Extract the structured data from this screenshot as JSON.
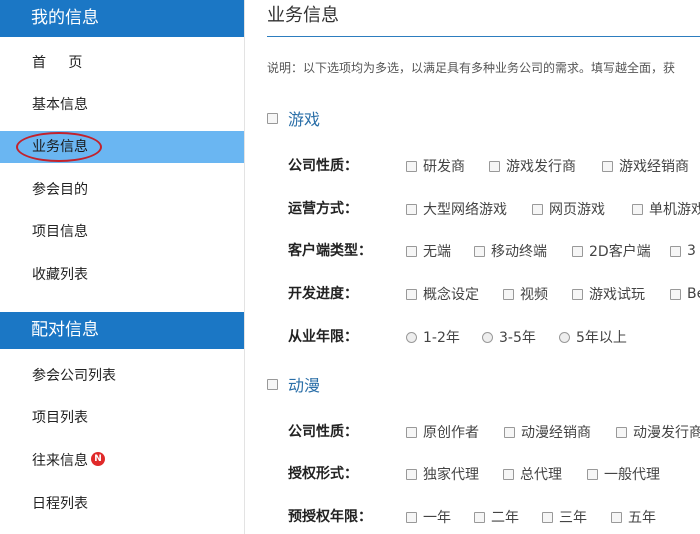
{
  "sidebar": {
    "section1_title": "我的信息",
    "section1_items": [
      "首页",
      "基本信息",
      "业务信息",
      "参会目的",
      "项目信息",
      "收藏列表"
    ],
    "section2_title": "配对信息",
    "section2_items": [
      "参会公司列表",
      "项目列表",
      "往来信息",
      "日程列表"
    ],
    "badge": "N"
  },
  "main": {
    "title": "业务信息",
    "description": "说明：以下选项均为多选，以满足具有多种业务公司的需求。填写越全面，获",
    "categories": [
      {
        "name": "游戏",
        "rows": [
          {
            "label": "公司性质：",
            "options": [
              "研发商",
              "游戏发行商",
              "游戏经销商"
            ]
          },
          {
            "label": "运营方式：",
            "options": [
              "大型网络游戏",
              "网页游戏",
              "单机游戏"
            ]
          },
          {
            "label": "客户端类型：",
            "options": [
              "无端",
              "移动终端",
              "2D客户端",
              "3"
            ]
          },
          {
            "label": "开发进度：",
            "options": [
              "概念设定",
              "视频",
              "游戏试玩",
              "Be"
            ]
          },
          {
            "label": "从业年限：",
            "options": [
              "1-2年",
              "3-5年",
              "5年以上"
            ]
          }
        ]
      },
      {
        "name": "动漫",
        "rows": [
          {
            "label": "公司性质：",
            "options": [
              "原创作者",
              "动漫经销商",
              "动漫发行商"
            ]
          },
          {
            "label": "授权形式：",
            "options": [
              "独家代理",
              "总代理",
              "一般代理"
            ]
          },
          {
            "label": "预授权年限：",
            "options": [
              "一年",
              "二年",
              "三年",
              "五年"
            ]
          }
        ]
      }
    ]
  }
}
